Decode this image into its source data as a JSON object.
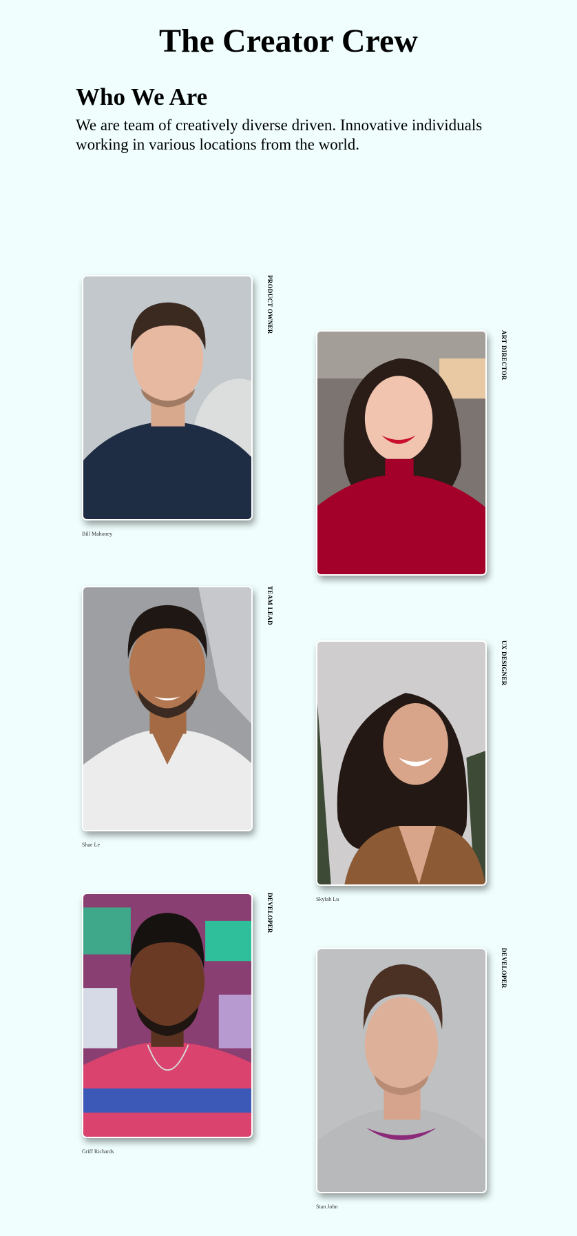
{
  "header": {
    "title": "The Creator Crew"
  },
  "about": {
    "heading": "Who We Are",
    "description": "We are team of creatively diverse driven. Innovative individuals working in various locations from the world."
  },
  "team": [
    {
      "name": "Bill Mahoney",
      "role": "PRODUCT OWNER"
    },
    {
      "name": "",
      "role": "ART DIRECTOR"
    },
    {
      "name": "Shae Le",
      "role": "TEAM LEAD"
    },
    {
      "name": "Skylah Lu",
      "role": "UX DESIGNER"
    },
    {
      "name": "Griff Richards",
      "role": "DEVELOPER"
    },
    {
      "name": "Stan John",
      "role": "DEVELOPER"
    }
  ],
  "colors": {
    "page_background": "#f0fffe",
    "text": "#000000",
    "card_border": "#ffffff"
  }
}
